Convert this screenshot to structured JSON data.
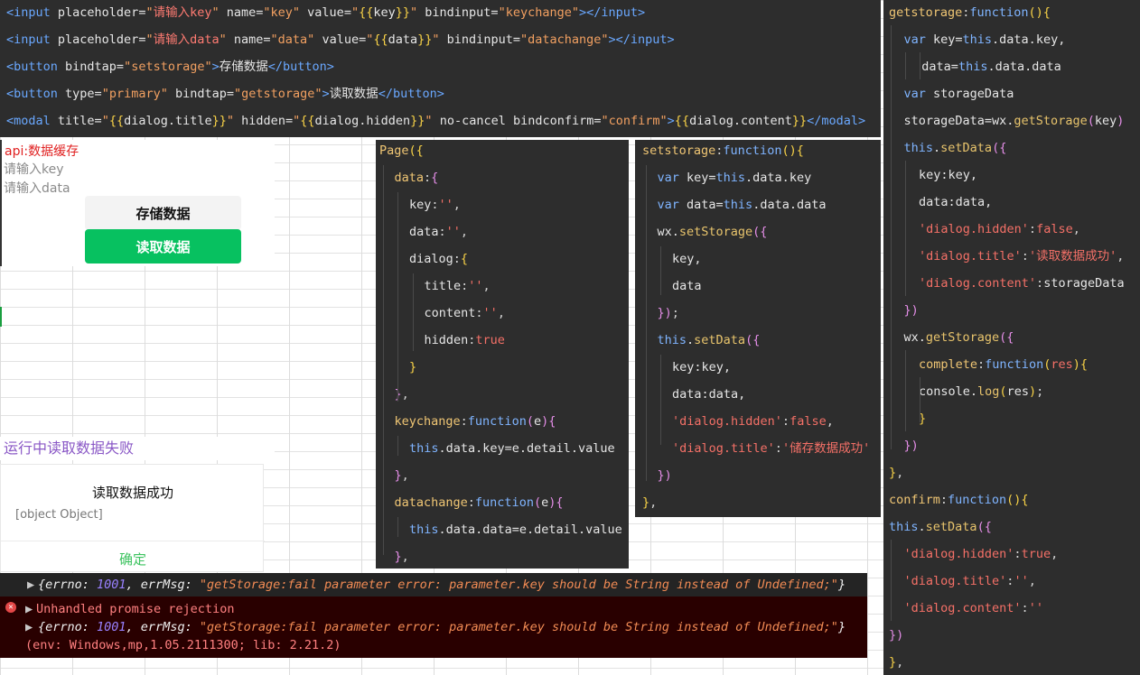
{
  "wxml": [
    {
      "parts": [
        [
          "t-tag",
          "<input"
        ],
        [
          "t-attr",
          " placeholder="
        ],
        [
          "t-str",
          "\""
        ],
        [
          "t-cn",
          "请输入key"
        ],
        [
          "t-str",
          "\""
        ],
        [
          "t-attr",
          " name="
        ],
        [
          "t-str",
          "\"key\""
        ],
        [
          "t-attr",
          " value="
        ],
        [
          "t-str",
          "\""
        ],
        [
          "t-br",
          "{{"
        ],
        [
          "t-plain",
          "key"
        ],
        [
          "t-br",
          "}}"
        ],
        [
          "t-str",
          "\""
        ],
        [
          "t-attr",
          " bindinput="
        ],
        [
          "t-str",
          "\"keychange\""
        ],
        [
          "t-tag",
          "></input>"
        ]
      ]
    },
    {
      "parts": [
        [
          "t-tag",
          "<input"
        ],
        [
          "t-attr",
          " placeholder="
        ],
        [
          "t-str",
          "\""
        ],
        [
          "t-cn",
          "请输入data"
        ],
        [
          "t-str",
          "\""
        ],
        [
          "t-attr",
          " name="
        ],
        [
          "t-str",
          "\"data\""
        ],
        [
          "t-attr",
          " value="
        ],
        [
          "t-str",
          "\""
        ],
        [
          "t-br",
          "{{"
        ],
        [
          "t-plain",
          "data"
        ],
        [
          "t-br",
          "}}"
        ],
        [
          "t-str",
          "\""
        ],
        [
          "t-attr",
          " bindinput="
        ],
        [
          "t-str",
          "\"datachange\""
        ],
        [
          "t-tag",
          "></input>"
        ]
      ]
    },
    {
      "parts": [
        [
          "t-tag",
          "<button"
        ],
        [
          "t-attr",
          " bindtap="
        ],
        [
          "t-str",
          "\"setstorage\""
        ],
        [
          "t-tag",
          ">"
        ],
        [
          "t-plain",
          "存储数据"
        ],
        [
          "t-tag",
          "</button>"
        ]
      ]
    },
    {
      "parts": [
        [
          "t-tag",
          "<button"
        ],
        [
          "t-attr",
          " type="
        ],
        [
          "t-str",
          "\"primary\""
        ],
        [
          "t-attr",
          " bindtap="
        ],
        [
          "t-str",
          "\"getstorage\""
        ],
        [
          "t-tag",
          ">"
        ],
        [
          "t-plain",
          "读取数据"
        ],
        [
          "t-tag",
          "</button>"
        ]
      ]
    },
    {
      "parts": [
        [
          "t-tag",
          "<modal"
        ],
        [
          "t-attr",
          " title="
        ],
        [
          "t-str",
          "\""
        ],
        [
          "t-br",
          "{{"
        ],
        [
          "t-plain",
          "dialog.title"
        ],
        [
          "t-br",
          "}}"
        ],
        [
          "t-str",
          "\""
        ],
        [
          "t-attr",
          " hidden="
        ],
        [
          "t-str",
          "\""
        ],
        [
          "t-br",
          "{{"
        ],
        [
          "t-plain",
          "dialog.hidden"
        ],
        [
          "t-br",
          "}}"
        ],
        [
          "t-str",
          "\""
        ],
        [
          "t-attr",
          " no-cancel bindconfirm="
        ],
        [
          "t-str",
          "\"confirm\""
        ],
        [
          "t-tag",
          ">"
        ],
        [
          "t-br",
          "{{"
        ],
        [
          "t-plain",
          "dialog.content"
        ],
        [
          "t-br",
          "}}"
        ],
        [
          "t-tag",
          "</modal>"
        ]
      ]
    }
  ],
  "page_js": [
    {
      "indent": 0,
      "parts": [
        [
          "t-fn",
          "Page"
        ],
        [
          "t-br",
          "({"
        ]
      ]
    },
    {
      "indent": 1,
      "parts": [
        [
          "t-fn",
          "data"
        ],
        [
          "t-punct",
          ":"
        ],
        [
          "t-br2",
          "{"
        ]
      ]
    },
    {
      "indent": 2,
      "parts": [
        [
          "t-key",
          "key"
        ],
        [
          "t-punct",
          ":"
        ],
        [
          "t-sq",
          "''"
        ],
        [
          "t-punct",
          ","
        ]
      ]
    },
    {
      "indent": 2,
      "parts": [
        [
          "t-key",
          "data"
        ],
        [
          "t-punct",
          ":"
        ],
        [
          "t-sq",
          "''"
        ],
        [
          "t-punct",
          ","
        ]
      ]
    },
    {
      "indent": 2,
      "parts": [
        [
          "t-key",
          "dialog"
        ],
        [
          "t-punct",
          ":"
        ],
        [
          "t-br",
          "{"
        ]
      ]
    },
    {
      "indent": 3,
      "parts": [
        [
          "t-key",
          "title"
        ],
        [
          "t-punct",
          ":"
        ],
        [
          "t-sq",
          "''"
        ],
        [
          "t-punct",
          ","
        ]
      ]
    },
    {
      "indent": 3,
      "parts": [
        [
          "t-key",
          "content"
        ],
        [
          "t-punct",
          ":"
        ],
        [
          "t-sq",
          "''"
        ],
        [
          "t-punct",
          ","
        ]
      ]
    },
    {
      "indent": 3,
      "parts": [
        [
          "t-key",
          "hidden"
        ],
        [
          "t-punct",
          ":"
        ],
        [
          "t-bool",
          "true"
        ]
      ]
    },
    {
      "indent": 2,
      "parts": [
        [
          "t-br",
          "}"
        ]
      ]
    },
    {
      "indent": 1,
      "parts": [
        [
          "t-br2",
          "}"
        ],
        [
          "t-punct",
          ","
        ]
      ]
    },
    {
      "indent": 1,
      "parts": [
        [
          "t-fn",
          "keychange"
        ],
        [
          "t-punct",
          ":"
        ],
        [
          "t-kw",
          "function"
        ],
        [
          "t-br2",
          "("
        ],
        [
          "t-plain",
          "e"
        ],
        [
          "t-br2",
          ")"
        ],
        [
          "t-br2",
          "{"
        ]
      ]
    },
    {
      "indent": 2,
      "parts": [
        [
          "t-this",
          "this"
        ],
        [
          "t-plain",
          ".data.key=e.detail.value"
        ]
      ]
    },
    {
      "indent": 1,
      "parts": [
        [
          "t-br2",
          "}"
        ],
        [
          "t-punct",
          ","
        ]
      ]
    },
    {
      "indent": 1,
      "parts": [
        [
          "t-fn",
          "datachange"
        ],
        [
          "t-punct",
          ":"
        ],
        [
          "t-kw",
          "function"
        ],
        [
          "t-br2",
          "("
        ],
        [
          "t-plain",
          "e"
        ],
        [
          "t-br2",
          ")"
        ],
        [
          "t-br2",
          "{"
        ]
      ]
    },
    {
      "indent": 2,
      "parts": [
        [
          "t-this",
          "this"
        ],
        [
          "t-plain",
          ".data.data=e.detail.value"
        ]
      ]
    },
    {
      "indent": 1,
      "parts": [
        [
          "t-br2",
          "}"
        ],
        [
          "t-punct",
          ","
        ]
      ]
    }
  ],
  "setstorage_js": [
    {
      "indent": 0,
      "parts": [
        [
          "t-fn",
          "setstorage"
        ],
        [
          "t-punct",
          ":"
        ],
        [
          "t-kw",
          "function"
        ],
        [
          "t-br",
          "()"
        ],
        [
          "t-br",
          "{"
        ]
      ]
    },
    {
      "indent": 1,
      "parts": [
        [
          "t-kw",
          "var"
        ],
        [
          "t-plain",
          " key="
        ],
        [
          "t-this",
          "this"
        ],
        [
          "t-plain",
          ".data.key"
        ]
      ]
    },
    {
      "indent": 1,
      "parts": [
        [
          "t-kw",
          "var"
        ],
        [
          "t-plain",
          " data="
        ],
        [
          "t-this",
          "this"
        ],
        [
          "t-plain",
          ".data.data"
        ]
      ]
    },
    {
      "indent": 1,
      "parts": [
        [
          "t-plain",
          "wx."
        ],
        [
          "t-method",
          "setStorage"
        ],
        [
          "t-br2",
          "({"
        ]
      ]
    },
    {
      "indent": 2,
      "parts": [
        [
          "t-plain",
          "key,"
        ]
      ]
    },
    {
      "indent": 2,
      "parts": [
        [
          "t-plain",
          "data"
        ]
      ]
    },
    {
      "indent": 1,
      "parts": [
        [
          "t-br2",
          "})"
        ],
        [
          "t-punct",
          ";"
        ]
      ]
    },
    {
      "indent": 1,
      "parts": [
        [
          "t-this",
          "this"
        ],
        [
          "t-plain",
          "."
        ],
        [
          "t-method",
          "setData"
        ],
        [
          "t-br2",
          "({"
        ]
      ]
    },
    {
      "indent": 2,
      "parts": [
        [
          "t-plain",
          "key:key,"
        ]
      ]
    },
    {
      "indent": 2,
      "parts": [
        [
          "t-plain",
          "data:data,"
        ]
      ]
    },
    {
      "indent": 2,
      "parts": [
        [
          "t-sq",
          "'dialog.hidden'"
        ],
        [
          "t-punct",
          ":"
        ],
        [
          "t-bool",
          "false"
        ],
        [
          "t-punct",
          ","
        ]
      ]
    },
    {
      "indent": 2,
      "parts": [
        [
          "t-sq",
          "'dialog.title'"
        ],
        [
          "t-punct",
          ":"
        ],
        [
          "t-sq",
          "'储存数据成功'"
        ]
      ]
    },
    {
      "indent": 1,
      "parts": [
        [
          "t-br2",
          "})"
        ]
      ]
    },
    {
      "indent": 0,
      "parts": [
        [
          "t-br",
          "}"
        ],
        [
          "t-punct",
          ","
        ]
      ]
    }
  ],
  "getstorage_js": [
    {
      "indent": 0,
      "parts": [
        [
          "t-fn",
          "getstorage"
        ],
        [
          "t-punct",
          ":"
        ],
        [
          "t-kw",
          "function"
        ],
        [
          "t-br",
          "()"
        ],
        [
          "t-br",
          "{"
        ]
      ]
    },
    {
      "indent": 1,
      "parts": [
        [
          "t-kw",
          "var"
        ],
        [
          "t-plain",
          " key="
        ],
        [
          "t-this",
          "this"
        ],
        [
          "t-plain",
          ".data.key,"
        ]
      ]
    },
    {
      "indent": 2.2,
      "parts": [
        [
          "t-plain",
          "data="
        ],
        [
          "t-this",
          "this"
        ],
        [
          "t-plain",
          ".data.data"
        ]
      ]
    },
    {
      "indent": 1,
      "parts": [
        [
          "t-kw",
          "var"
        ],
        [
          "t-plain",
          " storageData"
        ]
      ]
    },
    {
      "indent": 1,
      "parts": [
        [
          "t-plain",
          "storageData=wx."
        ],
        [
          "t-method",
          "getStorage"
        ],
        [
          "t-br2",
          "("
        ],
        [
          "t-plain",
          "key"
        ],
        [
          "t-br2",
          ")"
        ]
      ]
    },
    {
      "indent": 1,
      "parts": [
        [
          "t-this",
          "this"
        ],
        [
          "t-plain",
          "."
        ],
        [
          "t-method",
          "setData"
        ],
        [
          "t-br2",
          "({"
        ]
      ]
    },
    {
      "indent": 2,
      "parts": [
        [
          "t-plain",
          "key:key,"
        ]
      ]
    },
    {
      "indent": 2,
      "parts": [
        [
          "t-plain",
          "data:data,"
        ]
      ]
    },
    {
      "indent": 2,
      "parts": [
        [
          "t-sq",
          "'dialog.hidden'"
        ],
        [
          "t-punct",
          ":"
        ],
        [
          "t-bool",
          "false"
        ],
        [
          "t-punct",
          ","
        ]
      ]
    },
    {
      "indent": 2,
      "parts": [
        [
          "t-sq",
          "'dialog.title'"
        ],
        [
          "t-punct",
          ":"
        ],
        [
          "t-sq",
          "'读取数据成功'"
        ],
        [
          "t-punct",
          ","
        ]
      ]
    },
    {
      "indent": 2,
      "parts": [
        [
          "t-sq",
          "'dialog.content'"
        ],
        [
          "t-punct",
          ":"
        ],
        [
          "t-plain",
          "storageData"
        ]
      ]
    },
    {
      "indent": 1,
      "parts": [
        [
          "t-br2",
          "})"
        ]
      ]
    },
    {
      "indent": 1,
      "parts": [
        [
          "t-plain",
          "wx."
        ],
        [
          "t-method",
          "getStorage"
        ],
        [
          "t-br2",
          "({"
        ]
      ]
    },
    {
      "indent": 2,
      "parts": [
        [
          "t-fn",
          "complete"
        ],
        [
          "t-punct",
          ":"
        ],
        [
          "t-kw",
          "function"
        ],
        [
          "t-br",
          "("
        ],
        [
          "t-sq",
          "res"
        ],
        [
          "t-br",
          ")"
        ],
        [
          "t-br",
          "{"
        ]
      ]
    },
    {
      "indent": 2,
      "parts": [
        [
          "t-plain",
          "console."
        ],
        [
          "t-method",
          "log"
        ],
        [
          "t-br",
          "("
        ],
        [
          "t-plain",
          "res"
        ],
        [
          "t-br",
          ")"
        ],
        [
          "t-punct",
          ";"
        ]
      ]
    },
    {
      "indent": 2,
      "parts": [
        [
          "t-br",
          "}"
        ]
      ]
    },
    {
      "indent": 1,
      "parts": [
        [
          "t-br2",
          "})"
        ]
      ]
    },
    {
      "indent": 0,
      "parts": [
        [
          "t-br",
          "}"
        ],
        [
          "t-punct",
          ","
        ]
      ]
    },
    {
      "indent": 0,
      "parts": [
        [
          "t-fn",
          "confirm"
        ],
        [
          "t-punct",
          ":"
        ],
        [
          "t-kw",
          "function"
        ],
        [
          "t-br",
          "()"
        ],
        [
          "t-br",
          "{"
        ]
      ]
    },
    {
      "indent": 0,
      "parts": [
        [
          "t-this",
          "this"
        ],
        [
          "t-plain",
          "."
        ],
        [
          "t-method",
          "setData"
        ],
        [
          "t-br2",
          "({"
        ]
      ]
    },
    {
      "indent": 1,
      "parts": [
        [
          "t-sq",
          "'dialog.hidden'"
        ],
        [
          "t-punct",
          ":"
        ],
        [
          "t-bool",
          "true"
        ],
        [
          "t-punct",
          ","
        ]
      ]
    },
    {
      "indent": 1,
      "parts": [
        [
          "t-sq",
          "'dialog.title'"
        ],
        [
          "t-punct",
          ":"
        ],
        [
          "t-sq",
          "''"
        ],
        [
          "t-punct",
          ","
        ]
      ]
    },
    {
      "indent": 1,
      "parts": [
        [
          "t-sq",
          "'dialog.content'"
        ],
        [
          "t-punct",
          ":"
        ],
        [
          "t-sq",
          "''"
        ]
      ]
    },
    {
      "indent": 0,
      "parts": [
        [
          "t-br2",
          "})"
        ]
      ]
    },
    {
      "indent": 0,
      "parts": [
        [
          "t-br",
          "}"
        ],
        [
          "t-punct",
          ","
        ]
      ]
    }
  ],
  "preview": {
    "title": "api:数据缓存",
    "key_placeholder": "请输入key",
    "data_placeholder": "请输入data",
    "store_button": "存储数据",
    "read_button": "读取数据"
  },
  "caption": "运行中读取数据失败",
  "dialog": {
    "title": "读取数据成功",
    "content": "[object Object]",
    "confirm": "确定"
  },
  "console": {
    "log_line": [
      [
        "c-white",
        "{errno: "
      ],
      [
        "c-num",
        "1001"
      ],
      [
        "c-white",
        ", errMsg: "
      ],
      [
        "c-str",
        "\"getStorage:fail parameter error: parameter.key should be String instead of Undefined;\""
      ],
      [
        "c-white",
        "}"
      ]
    ],
    "error_title": "Unhandled promise rejection",
    "error_line": [
      [
        "c-white",
        "{errno: "
      ],
      [
        "c-num",
        "1001"
      ],
      [
        "c-white",
        ", errMsg: "
      ],
      [
        "c-str",
        "\"getStorage:fail parameter error: parameter.key should be String instead of Undefined;\""
      ],
      [
        "c-white",
        "}"
      ]
    ],
    "env": "(env: Windows,mp,1.05.2111300; lib: 2.21.2)"
  }
}
